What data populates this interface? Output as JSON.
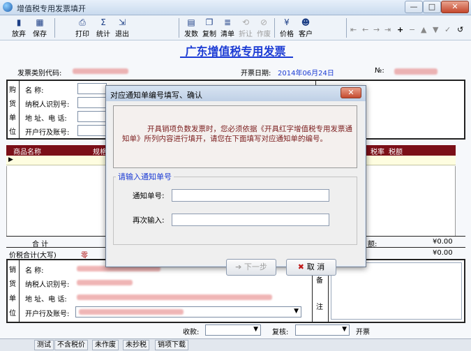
{
  "window": {
    "title": "增值税专用发票填开",
    "controls": [
      "—",
      "□",
      "✕"
    ]
  },
  "toolbar": {
    "left_buttons": [
      {
        "label": "放弃",
        "icon": "exit-icon"
      },
      {
        "label": "保存",
        "icon": "save-icon"
      },
      {
        "label": "打印",
        "icon": "print-icon"
      },
      {
        "label": "统计",
        "icon": "sum-icon"
      },
      {
        "label": "退出",
        "icon": "door-icon"
      }
    ],
    "right_buttons": [
      {
        "label": "发数",
        "icon": "count-icon"
      },
      {
        "label": "复制",
        "icon": "copy-icon"
      },
      {
        "label": "清单",
        "icon": "list-icon"
      },
      {
        "label": "折让",
        "icon": "discount-icon",
        "disabled": true
      },
      {
        "label": "作废",
        "icon": "void-icon",
        "disabled": true
      },
      {
        "label": "价格",
        "icon": "price-icon"
      },
      {
        "label": "客户",
        "icon": "client-icon"
      }
    ],
    "nav_glyphs": [
      "⇤",
      "←",
      "→",
      "⇥",
      "+",
      "−",
      "▲",
      "▼",
      "✓",
      "↺"
    ]
  },
  "invoice": {
    "title": "广东增值税专用发票",
    "category_code_label": "发票类别代码:",
    "date_label": "开票日期:",
    "date_value": "2014年06月24日",
    "number_label": "№:",
    "buyer_side": [
      "购",
      "货",
      "单",
      "位"
    ],
    "buyer_fields": [
      "名    称:",
      "纳税人识别号:",
      "地 址、电 话:",
      "开户行及账号:"
    ],
    "grid_headers": [
      "商品名称",
      "规格",
      "税率",
      "税额"
    ],
    "total_label": "合    计",
    "tax_total_label": "价税合计(大写)",
    "tax_total_value": "零",
    "total_right": "¥0.00",
    "tax_amount_label": "额:",
    "tax_amount_value": "¥0.00",
    "seller_side": [
      "销",
      "货",
      "单",
      "位"
    ],
    "seller_fields": [
      "名    称:",
      "纳税人识别号:",
      "地 址、电 话:",
      "开户行及账号:"
    ],
    "notes_side": [
      "备",
      "注"
    ],
    "payee_label": "收款:",
    "reviewer_label": "复核:",
    "issuer_label": "开票"
  },
  "dialog": {
    "title": "对应通知单编号填写、确认",
    "close_glyph": "✕",
    "notice": "开具销项负数发票时，您必须依据《开具红字增值税专用发票通知单》所列内容进行填开，请您在下面填写对应通知单的编号。",
    "group_title": "请输入通知单号",
    "field1_label": "通知单号:",
    "field2_label": "再次输入:",
    "next_button": "下一步",
    "cancel_button": "取 消"
  },
  "statusbar": {
    "items": [
      "测试",
      "不含税价",
      "未作废",
      "未抄税",
      "销项下载"
    ]
  }
}
